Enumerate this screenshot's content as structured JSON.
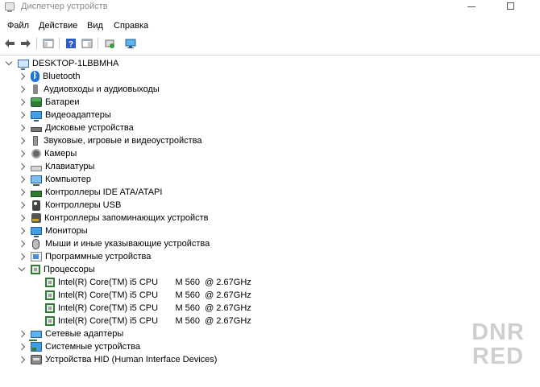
{
  "window": {
    "title": "Диспетчер устройств"
  },
  "menu": [
    "Файл",
    "Действие",
    "Вид",
    "Справка"
  ],
  "toolbar": {
    "buttons": [
      "back-arrow-icon",
      "forward-arrow-icon",
      "show-hide-console-tree-icon",
      "help-icon",
      "properties-icon",
      "update-driver-icon",
      "scan-hardware-icon"
    ]
  },
  "tree": {
    "root": "DESKTOP-1LBBMHA",
    "categories": [
      {
        "label": "Bluetooth",
        "icon": "bluetooth-icon",
        "expanded": false
      },
      {
        "label": "Аудиовходы и аудиовыходы",
        "icon": "audio-io-icon",
        "expanded": false
      },
      {
        "label": "Батареи",
        "icon": "battery-icon",
        "expanded": false
      },
      {
        "label": "Видеоадаптеры",
        "icon": "display-adapter-icon",
        "expanded": false
      },
      {
        "label": "Дисковые устройства",
        "icon": "disk-drive-icon",
        "expanded": false
      },
      {
        "label": "Звуковые, игровые и видеоустройства",
        "icon": "sound-device-icon",
        "expanded": false
      },
      {
        "label": "Камеры",
        "icon": "camera-icon",
        "expanded": false
      },
      {
        "label": "Клавиатуры",
        "icon": "keyboard-icon",
        "expanded": false
      },
      {
        "label": "Компьютер",
        "icon": "computer-icon",
        "expanded": false
      },
      {
        "label": "Контроллеры IDE ATA/ATAPI",
        "icon": "ide-controller-icon",
        "expanded": false
      },
      {
        "label": "Контроллеры USB",
        "icon": "usb-controller-icon",
        "expanded": false
      },
      {
        "label": "Контроллеры запоминающих устройств",
        "icon": "storage-controller-icon",
        "expanded": false
      },
      {
        "label": "Мониторы",
        "icon": "monitor-icon",
        "expanded": false
      },
      {
        "label": "Мыши и иные указывающие устройства",
        "icon": "mouse-icon",
        "expanded": false
      },
      {
        "label": "Программные устройства",
        "icon": "software-device-icon",
        "expanded": false
      },
      {
        "label": "Процессоры",
        "icon": "processor-icon",
        "expanded": true,
        "children": [
          "Intel(R) Core(TM) i5 CPU       M 560  @ 2.67GHz",
          "Intel(R) Core(TM) i5 CPU       M 560  @ 2.67GHz",
          "Intel(R) Core(TM) i5 CPU       M 560  @ 2.67GHz",
          "Intel(R) Core(TM) i5 CPU       M 560  @ 2.67GHz"
        ]
      },
      {
        "label": "Сетевые адаптеры",
        "icon": "network-adapter-icon",
        "expanded": false
      },
      {
        "label": "Системные устройства",
        "icon": "system-device-icon",
        "expanded": false
      },
      {
        "label": "Устройства HID (Human Interface Devices)",
        "icon": "hid-device-icon",
        "expanded": false
      }
    ]
  },
  "watermark": [
    "DNR",
    "RED"
  ]
}
